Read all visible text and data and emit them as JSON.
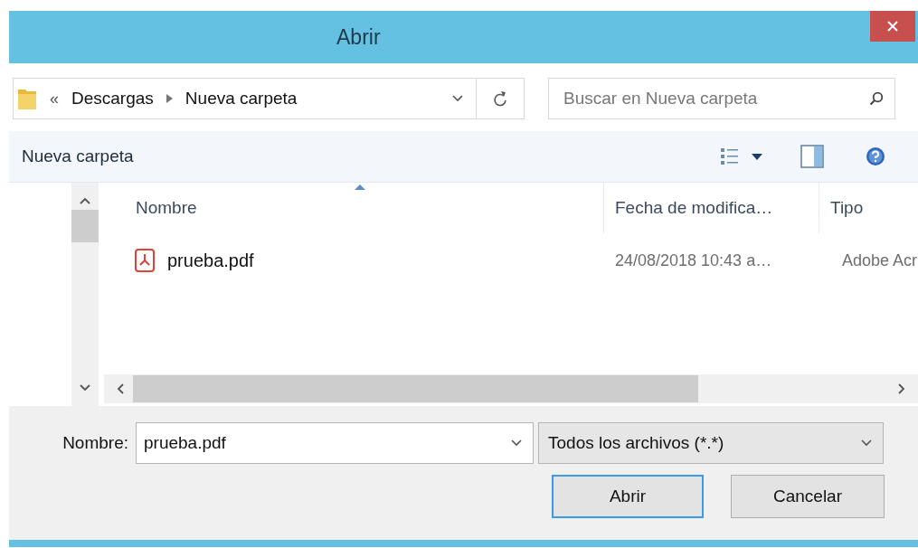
{
  "window": {
    "title": "Abrir"
  },
  "address_bar": {
    "overflow": "«",
    "segments": [
      "Descargas",
      "Nueva carpeta"
    ]
  },
  "search": {
    "placeholder": "Buscar en Nueva carpeta"
  },
  "toolbar": {
    "new_folder": "Nueva carpeta"
  },
  "file_list": {
    "columns": [
      {
        "label": "Nombre",
        "sorted": true
      },
      {
        "label": "Fecha de modifica…",
        "sorted": false
      },
      {
        "label": "Tipo",
        "sorted": false
      }
    ],
    "rows": [
      {
        "cells": [
          "prueba.pdf",
          "24/08/2018 10:43 a…",
          "Adobe Acr"
        ]
      }
    ]
  },
  "file_name": {
    "label": "Nombre:",
    "value": "prueba.pdf"
  },
  "file_type": {
    "value": "Todos los archivos (*.*)"
  },
  "buttons": [
    {
      "label": "Abrir",
      "default": true
    },
    {
      "label": "Cancelar",
      "default": false
    }
  ]
}
